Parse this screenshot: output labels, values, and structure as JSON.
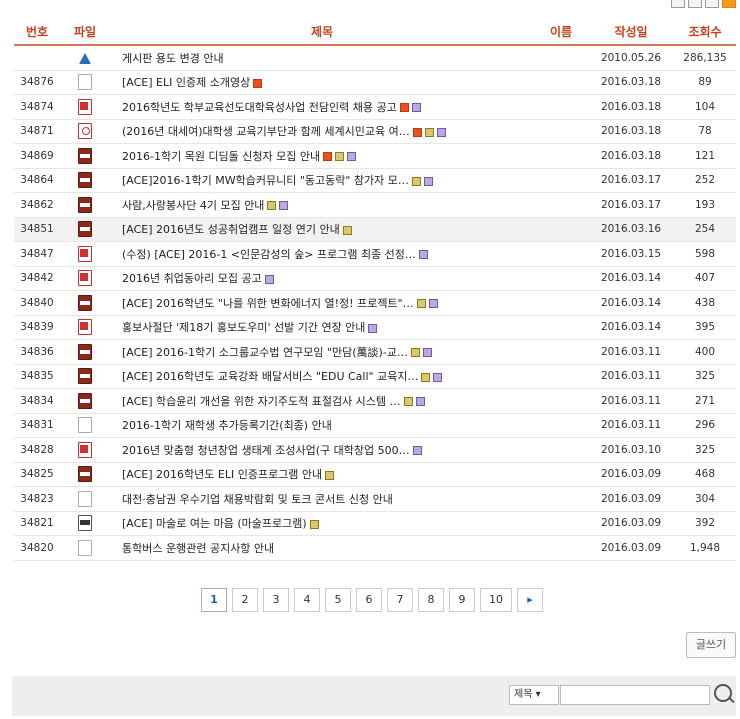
{
  "header": {
    "num": "번호",
    "file": "파일",
    "title": "제목",
    "name": "이름",
    "date": "작성일",
    "views": "조회수"
  },
  "rows": [
    {
      "num": "",
      "file": "warning-icon",
      "title": "게시판 용도 변경 안내",
      "badges": [],
      "date": "2010.05.26",
      "views": "286,135",
      "hl": false
    },
    {
      "num": "34876",
      "file": "document-icon",
      "title": "[ACE] ELI 인증제 소개영상",
      "badges": [
        "new"
      ],
      "date": "2016.03.18",
      "views": "89",
      "hl": false
    },
    {
      "num": "34874",
      "file": "ppt-file-icon",
      "title": "2016학년도 학부교육선도대학육성사업 전담인력 채용 공고",
      "badges": [
        "new",
        "hwp"
      ],
      "date": "2016.03.18",
      "views": "104",
      "hl": false
    },
    {
      "num": "34871",
      "file": "pdf-file-icon",
      "title": "(2016년 대세여)대학생 교육기부단과 함께 세계시민교육 여…",
      "badges": [
        "new",
        "img",
        "hwp"
      ],
      "date": "2016.03.18",
      "views": "78",
      "hl": false
    },
    {
      "num": "34869",
      "file": "jpg-file-icon",
      "title": "2016-1학기 목원 디딤돌 신청자 모집 안내",
      "badges": [
        "new",
        "img",
        "hwp"
      ],
      "date": "2016.03.18",
      "views": "121",
      "hl": false
    },
    {
      "num": "34864",
      "file": "jpg-file-icon",
      "title": "[ACE]2016-1학기 MW학습커뮤니티 \"동고동락\" 참가자 모…",
      "badges": [
        "img",
        "hwp"
      ],
      "date": "2016.03.17",
      "views": "252",
      "hl": false
    },
    {
      "num": "34862",
      "file": "jpg-file-icon",
      "title": "사람,사랑봉사단 4기 모집 안내",
      "badges": [
        "img",
        "hwp"
      ],
      "date": "2016.03.17",
      "views": "193",
      "hl": false
    },
    {
      "num": "34851",
      "file": "jpg-file-icon",
      "title": "[ACE] 2016년도 성공취업캠프 일정 연기 안내",
      "badges": [
        "img"
      ],
      "date": "2016.03.16",
      "views": "254",
      "hl": true
    },
    {
      "num": "34847",
      "file": "ppt-file-icon",
      "title": "(수정) [ACE] 2016-1 <인문감성의 숲> 프로그램 최종 선정…",
      "badges": [
        "hwp"
      ],
      "date": "2016.03.15",
      "views": "598",
      "hl": false
    },
    {
      "num": "34842",
      "file": "ppt-file-icon",
      "title": "2016년 취업동아리 모집 공고",
      "badges": [
        "hwp"
      ],
      "date": "2016.03.14",
      "views": "407",
      "hl": false
    },
    {
      "num": "34840",
      "file": "jpg-file-icon",
      "title": "[ACE] 2016학년도 \"나를 위한 변화에너지 열!정! 프로젝트\"…",
      "badges": [
        "img",
        "hwp"
      ],
      "date": "2016.03.14",
      "views": "438",
      "hl": false
    },
    {
      "num": "34839",
      "file": "ppt-file-icon",
      "title": "홍보사절단 '제18기 홍보도우미' 선발 기간 연장 안내",
      "badges": [
        "hwp"
      ],
      "date": "2016.03.14",
      "views": "395",
      "hl": false
    },
    {
      "num": "34836",
      "file": "jpg-file-icon",
      "title": "[ACE] 2016-1학기 소그룹교수법 연구모임 \"만담(萬談)-교…",
      "badges": [
        "img",
        "hwp"
      ],
      "date": "2016.03.11",
      "views": "400",
      "hl": false
    },
    {
      "num": "34835",
      "file": "jpg-file-icon",
      "title": "[ACE] 2016학년도 교육강좌 배달서비스 \"EDU Call\" 교육지…",
      "badges": [
        "img",
        "hwp"
      ],
      "date": "2016.03.11",
      "views": "325",
      "hl": false
    },
    {
      "num": "34834",
      "file": "jpg-file-icon",
      "title": "[ACE] 학습윤리 개선을 위한 자기주도적 표절검사 시스템 …",
      "badges": [
        "img",
        "hwp"
      ],
      "date": "2016.03.11",
      "views": "271",
      "hl": false
    },
    {
      "num": "34831",
      "file": "document-icon",
      "title": "2016-1학기 재학생 추가등록기간(최종) 안내",
      "badges": [],
      "date": "2016.03.11",
      "views": "296",
      "hl": false
    },
    {
      "num": "34828",
      "file": "ppt-file-icon",
      "title": "2016년 맞춤형 청년창업 생태계 조성사업(구 대학창업 500…",
      "badges": [
        "hwp"
      ],
      "date": "2016.03.10",
      "views": "325",
      "hl": false
    },
    {
      "num": "34825",
      "file": "jpg-file-icon",
      "title": "[ACE] 2016학년도 ELI 인증프로그램 안내",
      "badges": [
        "img"
      ],
      "date": "2016.03.09",
      "views": "468",
      "hl": false
    },
    {
      "num": "34823",
      "file": "document-icon",
      "title": "대전·충남권 우수기업 채용박람회 및 토크 콘서트 신청 안내",
      "badges": [],
      "date": "2016.03.09",
      "views": "304",
      "hl": false
    },
    {
      "num": "34821",
      "file": "etc-file-icon",
      "title": "[ACE] 마술로 여는 마음 (마술프로그램)",
      "badges": [
        "img"
      ],
      "date": "2016.03.09",
      "views": "392",
      "hl": false
    },
    {
      "num": "34820",
      "file": "document-icon",
      "title": "통학버스 운행관련 공지사항 안내",
      "badges": [],
      "date": "2016.03.09",
      "views": "1,948",
      "hl": false
    }
  ],
  "pagination": {
    "pages": [
      "1",
      "2",
      "3",
      "4",
      "5",
      "6",
      "7",
      "8",
      "9",
      "10"
    ],
    "current": "1",
    "next_label": "▸"
  },
  "write_label": "글쓰기",
  "search": {
    "select_value": "제목 ▾",
    "input_value": ""
  }
}
